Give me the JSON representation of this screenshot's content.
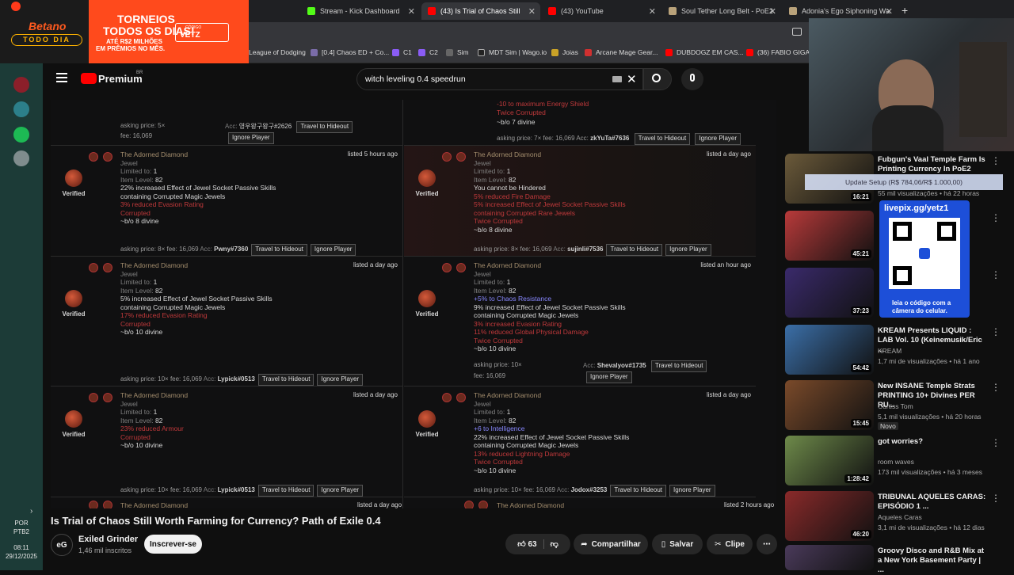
{
  "browser": {
    "tabs": [
      {
        "label": "",
        "x": 0
      },
      {
        "label": "Stream - Kick Dashboard"
      },
      {
        "label": "(43) Is Trial of Chaos Still"
      },
      {
        "label": "(43) YouTube"
      },
      {
        "label": "Soul Tether Long Belt - PoE2"
      },
      {
        "label": "Adonia's Ego Siphoning Wa"
      }
    ],
    "bookmarks": [
      "League of Dodging",
      "[0.4] Chaos ED + Co...",
      "C1",
      "C2",
      "Sim",
      "MDT Sim | Wago.io",
      "Joias",
      "Arcane Mage Gear...",
      "DUBDOGZ EM CAS...",
      "(36) FABIO GIGA S"
    ]
  },
  "banner": {
    "brand": "Betano",
    "sub": "TODO DIA",
    "line1": "TORNEIOS",
    "line2": "TODOS OS DIAS!",
    "line3": "ATÉ R$2 MILHÕES",
    "line4": "EM PRÊMIOS NO MÊS.",
    "code_label": "CÓDIGO",
    "code": "VETZ"
  },
  "youtube": {
    "logo": "Premium",
    "region": "BR",
    "search_value": "witch leveling 0.4 speedrun"
  },
  "trade": {
    "top_left": {
      "asking": "asking price: 5×",
      "fee_label": "fee:",
      "fee": "16,069",
      "acc_label": "Acc:",
      "acc": "영우왕구왕구#2626",
      "travel": "Travel to Hideout",
      "ignore": "Ignore Player"
    },
    "top_right": {
      "mod1": "-10 to maximum Energy Shield",
      "mod2": "Twice Corrupted",
      "divine": "~b/o 7 divine",
      "asking": "asking price: 7×",
      "fee_label": "fee:",
      "fee": "16,069",
      "acc_label": "Acc:",
      "acc": "zkYuTa#7636",
      "travel": "Travel to Hideout",
      "ignore": "Ignore Player"
    },
    "items": [
      {
        "name": "The Adorned Diamond",
        "type": "Jewel",
        "limited": "Limited to:",
        "limited_val": "1",
        "ilvl": "Item Level:",
        "ilvl_val": "82",
        "mods_blue": [],
        "mods_white": [
          "22% increased Effect of Jewel Socket Passive Skills",
          "containing Corrupted Magic Jewels"
        ],
        "mods_red": [
          "3% reduced Evasion Rating",
          "Corrupted"
        ],
        "divine": "~b/o 8 divine",
        "listed": "listed 5 hours ago",
        "verified": "Verified",
        "asking": "asking price: 8×",
        "fee_label": "fee:",
        "fee": "16,069",
        "acc_label": "Acc:",
        "acc": "Pwny#7360",
        "travel": "Travel to Hideout",
        "ignore": "Ignore Player"
      },
      {
        "name": "The Adorned Diamond",
        "type": "Jewel",
        "limited": "Limited to:",
        "limited_val": "1",
        "ilvl": "Item Level:",
        "ilvl_val": "82",
        "mods_blue": [],
        "mods_white": [
          "You cannot be Hindered"
        ],
        "mods_red": [
          "5% reduced Fire Damage",
          "5% increased Effect of Jewel Socket Passive Skills",
          "containing Corrupted Rare Jewels",
          "Twice Corrupted"
        ],
        "divine": "~b/o 8 divine",
        "listed": "listed a day ago",
        "verified": "Verified",
        "asking": "asking price: 8×",
        "fee_label": "fee:",
        "fee": "16,069",
        "acc_label": "Acc:",
        "acc": "sujinli#7536",
        "travel": "Travel to Hideout",
        "ignore": "Ignore Player"
      },
      {
        "name": "The Adorned Diamond",
        "type": "Jewel",
        "limited": "Limited to:",
        "limited_val": "1",
        "ilvl": "Item Level:",
        "ilvl_val": "82",
        "mods_blue": [],
        "mods_white": [
          "5% increased Effect of Jewel Socket Passive Skills",
          "containing Corrupted Magic Jewels"
        ],
        "mods_red": [
          "17% reduced Evasion Rating",
          "Corrupted"
        ],
        "divine": "~b/o 10 divine",
        "listed": "listed a day ago",
        "verified": "Verified",
        "asking": "asking price: 10×",
        "fee_label": "fee:",
        "fee": "16,069",
        "acc_label": "Acc:",
        "acc": "Lypick#0513",
        "travel": "Travel to Hideout",
        "ignore": "Ignore Player"
      },
      {
        "name": "The Adorned Diamond",
        "type": "Jewel",
        "limited": "Limited to:",
        "limited_val": "1",
        "ilvl": "Item Level:",
        "ilvl_val": "82",
        "mods_blue": [
          "+5% to Chaos Resistance"
        ],
        "mods_white": [
          "9% increased Effect of Jewel Socket Passive Skills",
          "containing Corrupted Magic Jewels"
        ],
        "mods_red": [
          "3% increased Evasion Rating",
          "11% reduced Global Physical Damage",
          "Twice Corrupted"
        ],
        "divine": "~b/o 10 divine",
        "listed": "listed an hour ago",
        "verified": "Verified",
        "asking": "asking price: 10×",
        "fee_label": "fee:",
        "fee": "16,069",
        "acc_label": "Acc:",
        "acc": "Shevalyov#1735",
        "travel": "Travel to Hideout",
        "ignore": "Ignore Player"
      },
      {
        "name": "The Adorned Diamond",
        "type": "Jewel",
        "limited": "Limited to:",
        "limited_val": "1",
        "ilvl": "Item Level:",
        "ilvl_val": "82",
        "mods_blue": [],
        "mods_white": [],
        "mods_red": [
          "23% reduced Armour",
          "Corrupted"
        ],
        "divine": "~b/o 10 divine",
        "listed": "listed a day ago",
        "verified": "Verified",
        "asking": "asking price: 10×",
        "fee_label": "fee:",
        "fee": "16,069",
        "acc_label": "Acc:",
        "acc": "Lypick#0513",
        "travel": "Travel to Hideout",
        "ignore": "Ignore Player"
      },
      {
        "name": "The Adorned Diamond",
        "type": "Jewel",
        "limited": "Limited to:",
        "limited_val": "1",
        "ilvl": "Item Level:",
        "ilvl_val": "82",
        "mods_blue": [
          "+6 to Intelligence"
        ],
        "mods_white": [
          "22% increased Effect of Jewel Socket Passive Skills",
          "containing Corrupted Magic Jewels"
        ],
        "mods_red": [
          "13% reduced Lightning Damage",
          "Twice Corrupted"
        ],
        "divine": "~b/o 10 divine",
        "listed": "listed a day ago",
        "verified": "Verified",
        "asking": "asking price: 10×",
        "fee_label": "fee:",
        "fee": "16,069",
        "acc_label": "Acc:",
        "acc": "Jodox#3253",
        "travel": "Travel to Hideout",
        "ignore": "Ignore Player"
      }
    ],
    "bottom_left": {
      "name": "The Adorned Diamond",
      "listed": "listed a day ago"
    },
    "bottom_right": {
      "name": "The Adorned Diamond",
      "listed": "listed 2 hours ago"
    }
  },
  "video": {
    "title": "Is Trial of Chaos Still Worth Farming for Currency? Path of Exile 0.4",
    "channel": "Exiled Grinder",
    "channel_initials": "eG",
    "subs": "1,46 mil inscritos",
    "subscribe": "Inscrever-se",
    "likes": "63",
    "share": "Compartilhar",
    "save": "Salvar",
    "clip": "Clipe"
  },
  "overlay": {
    "update_text": "Update Setup (R$ 784,06/R$ 1.000,00)",
    "livepix_url": "livepix.gg/yetz1",
    "livepix_caption1": "leia o código com a",
    "livepix_caption2": "câmera do celular."
  },
  "sidebar": [
    {
      "title": "Fubgun's Vaal Temple Farm Is Printing Currency In PoE2",
      "channel": "",
      "meta": "55 mil visualizações • há 22 horas",
      "duration": "16:21"
    },
    {
      "title": "",
      "channel": "",
      "meta": "",
      "duration": "45:21"
    },
    {
      "title": "",
      "channel": "",
      "meta": "",
      "duration": "37:23"
    },
    {
      "title": "KREAM Presents LIQUID : LAB Vol. 10 (Keinemusik/Eric ...",
      "channel": "KREAM",
      "meta": "1,7 mi de visualizações • há 1 ano",
      "duration": "54:42"
    },
    {
      "title": "New INSANE Temple Strats PRINTING 10+ Divines PER RU...",
      "channel": "Curtiss Tom",
      "meta": "5,1 mil visualizações • há 20 horas",
      "badge": "Novo",
      "duration": "15:45"
    },
    {
      "title": "got worries?",
      "channel": "room waves",
      "meta": "173 mil visualizações • há 3 meses",
      "duration": "1:28:42"
    },
    {
      "title": "TRIBUNAL AQUELES CARAS: EPISÓDIO 1 ...",
      "channel": "Aqueles Caras",
      "meta": "3,1 mi de visualizações • há 12 dias",
      "duration": "46:20"
    },
    {
      "title": "Groovy Disco and R&B Mix at a New York Basement Party | ...",
      "channel": "",
      "meta": "",
      "duration": ""
    }
  ],
  "taskbar": {
    "lang": "POR",
    "layout": "PTB2",
    "time": "08:11",
    "date": "29/12/2025"
  }
}
